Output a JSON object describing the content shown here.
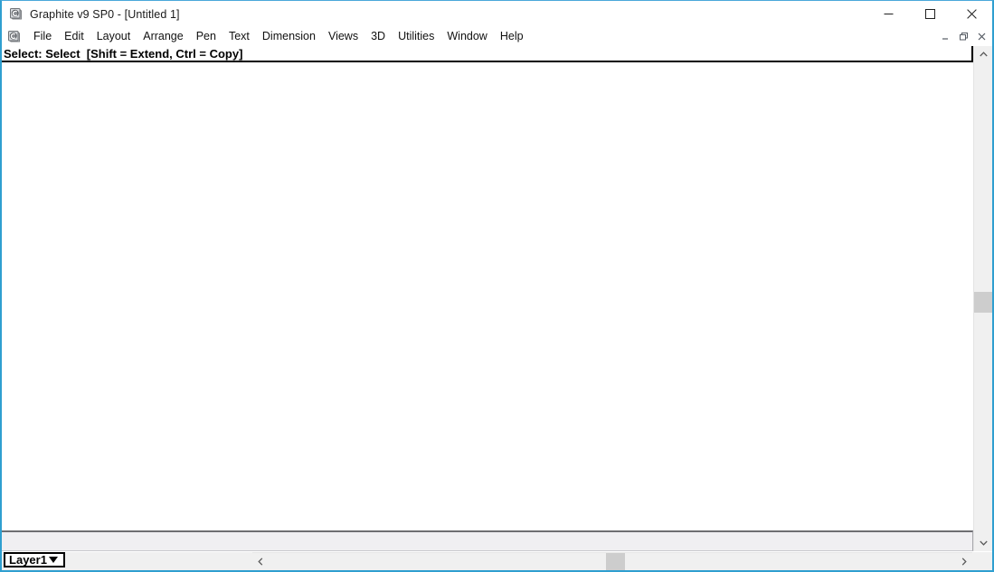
{
  "window": {
    "title": "Graphite v9 SP0 - [Untitled 1]",
    "app_icon": "graphite-app-icon",
    "controls": {
      "minimize": "minimize-icon",
      "maximize": "maximize-icon",
      "close": "close-icon"
    }
  },
  "menubar": {
    "doc_icon": "document-app-icon",
    "items": [
      {
        "label": "File"
      },
      {
        "label": "Edit"
      },
      {
        "label": "Layout"
      },
      {
        "label": "Arrange"
      },
      {
        "label": "Pen"
      },
      {
        "label": "Text"
      },
      {
        "label": "Dimension"
      },
      {
        "label": "Views"
      },
      {
        "label": "3D"
      },
      {
        "label": "Utilities"
      },
      {
        "label": "Window"
      },
      {
        "label": "Help"
      }
    ],
    "mdi_controls": {
      "minimize": "mdi-minimize-icon",
      "restore": "mdi-restore-icon",
      "close": "mdi-close-icon"
    }
  },
  "prompt": {
    "text": "Select: Select  [Shift = Extend, Ctrl = Copy]"
  },
  "statusbar": {
    "text": ""
  },
  "layer": {
    "name": "Layer1",
    "dropdown_icon": "chevron-down-icon"
  },
  "scrollbars": {
    "vertical": {
      "up_icon": "chevron-up-icon",
      "down_icon": "chevron-down-icon"
    },
    "horizontal": {
      "left_icon": "chevron-left-icon",
      "right_icon": "chevron-right-icon"
    }
  },
  "colors": {
    "frame_border": "#2f9fd0",
    "prompt_border": "#000000",
    "scroll_thumb": "#cdcdcd",
    "status_bg": "#f0eff2",
    "canvas_bg": "#ffffff"
  }
}
